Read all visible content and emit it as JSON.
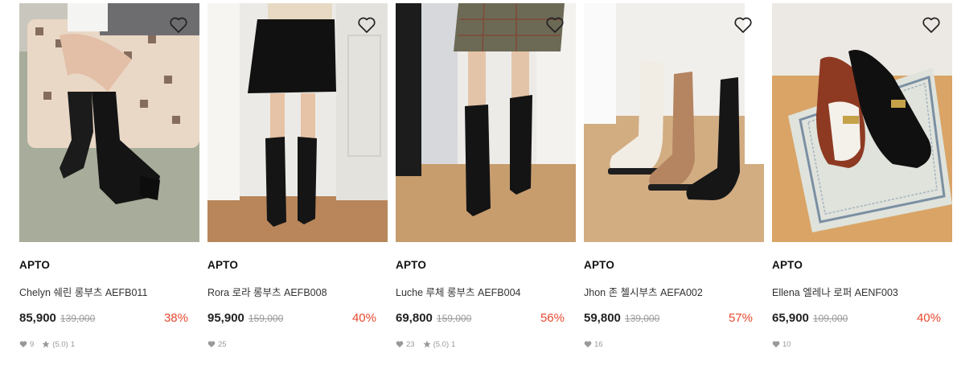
{
  "products": [
    {
      "brand": "APTO",
      "name": "Chelyn 쉐린 롱부츠 AEFB011",
      "price": "85,900",
      "original_price": "139,000",
      "discount": "38%",
      "likes": "9",
      "rating": "(5.0)",
      "reviews": "1"
    },
    {
      "brand": "APTO",
      "name": "Rora 로라 롱부츠 AEFB008",
      "price": "95,900",
      "original_price": "159,000",
      "discount": "40%",
      "likes": "25"
    },
    {
      "brand": "APTO",
      "name": "Luche 루체 롱부츠 AEFB004",
      "price": "69,800",
      "original_price": "159,000",
      "discount": "56%",
      "likes": "23",
      "rating": "(5.0)",
      "reviews": "1"
    },
    {
      "brand": "APTO",
      "name": "Jhon 존 첼시부츠 AEFA002",
      "price": "59,800",
      "original_price": "139,000",
      "discount": "57%",
      "likes": "16"
    },
    {
      "brand": "APTO",
      "name": "Ellena 엘레나 로퍼 AENF003",
      "price": "65,900",
      "original_price": "109,000",
      "discount": "40%",
      "likes": "10"
    }
  ],
  "icons": {
    "wishlist": "heart-outline-icon",
    "likes": "heart-icon",
    "rating": "star-icon"
  },
  "colors": {
    "discount": "#e8492f",
    "price": "#222222",
    "original_price": "#999999",
    "meta": "#999999"
  }
}
